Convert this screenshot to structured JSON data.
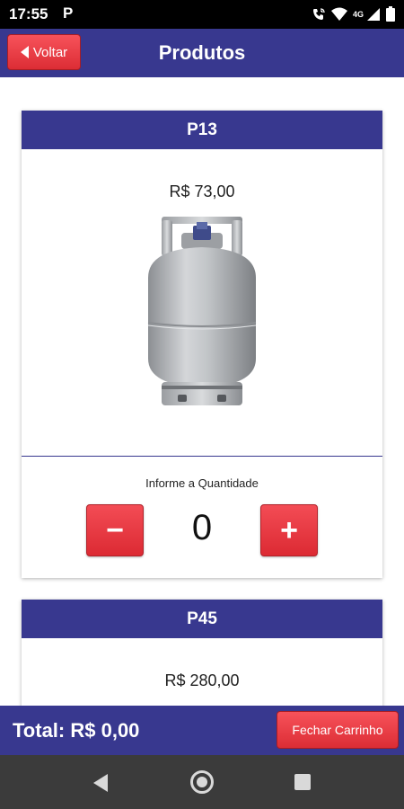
{
  "status_bar": {
    "time": "17:55",
    "app_indicator": "P",
    "network_label": "4G",
    "icons": [
      "wifi-calling-icon",
      "wifi-icon",
      "signal-icon",
      "battery-icon"
    ]
  },
  "header": {
    "back_label": "Voltar",
    "title": "Produtos"
  },
  "products": [
    {
      "name": "P13",
      "price": "R$ 73,00",
      "quantity_label": "Informe a Quantidade",
      "quantity": "0",
      "decrement_symbol": "−",
      "increment_symbol": "+",
      "image": "gas-cylinder-image"
    },
    {
      "name": "P45",
      "price": "R$ 280,00"
    }
  ],
  "footer": {
    "total": "Total: R$ 0,00",
    "checkout_label": "Fechar Carrinho"
  },
  "navigation": {
    "icons": [
      "back-icon",
      "home-icon",
      "recent-apps-icon"
    ]
  },
  "colors": {
    "primary": "#38388f",
    "accent": "#e0343c",
    "nav_bar": "#3b3b3b",
    "status_bar": "#000000"
  }
}
